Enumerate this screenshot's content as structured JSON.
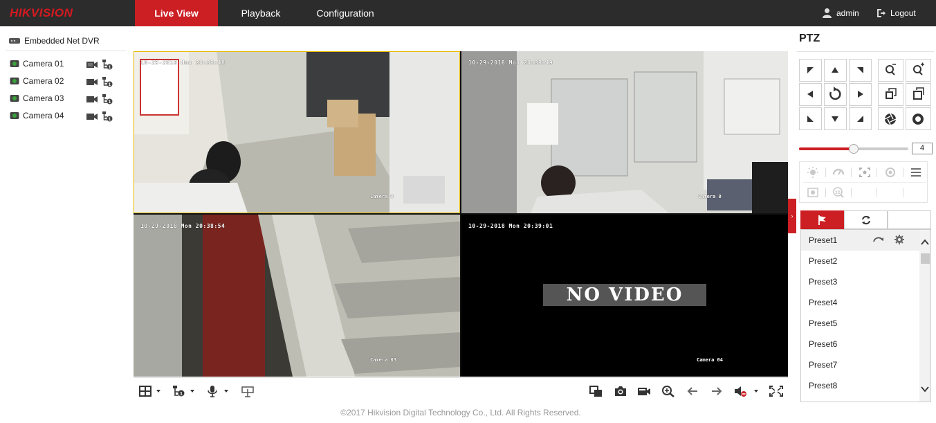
{
  "brand": {
    "logo_text": "HIKVISION",
    "accent": "#cc1f24",
    "logo_color": "#d71920"
  },
  "nav": {
    "tabs": [
      {
        "label": "Live View",
        "active": true
      },
      {
        "label": "Playback"
      },
      {
        "label": "Configuration"
      }
    ],
    "user": "admin",
    "logout": "Logout"
  },
  "tree": {
    "root": "Embedded Net DVR",
    "cameras": [
      {
        "label": "Camera 01"
      },
      {
        "label": "Camera 02"
      },
      {
        "label": "Camera 03"
      },
      {
        "label": "Camera 04"
      }
    ]
  },
  "video": {
    "panes": [
      {
        "timestamp": "10-29-2018 Mon 20:38:48",
        "name": "Camera 0",
        "selected": true
      },
      {
        "timestamp": "10-29-2018 Mon 20:38:49",
        "name": "Camera 0"
      },
      {
        "timestamp": "10-29-2018 Mon 20:38:54",
        "name": "Camera 03"
      },
      {
        "timestamp": "10-29-2018 Mon 20:39:01",
        "name": "Camera 04",
        "overlay": "NO VIDEO"
      }
    ]
  },
  "footer": "©2017 Hikvision Digital Technology Co., Ltd. All Rights Reserved.",
  "ptz": {
    "title": "PTZ",
    "speed": "4",
    "speed_fraction": 0.5,
    "presets": [
      "Preset1",
      "Preset2",
      "Preset3",
      "Preset4",
      "Preset5",
      "Preset6",
      "Preset7",
      "Preset8"
    ]
  }
}
